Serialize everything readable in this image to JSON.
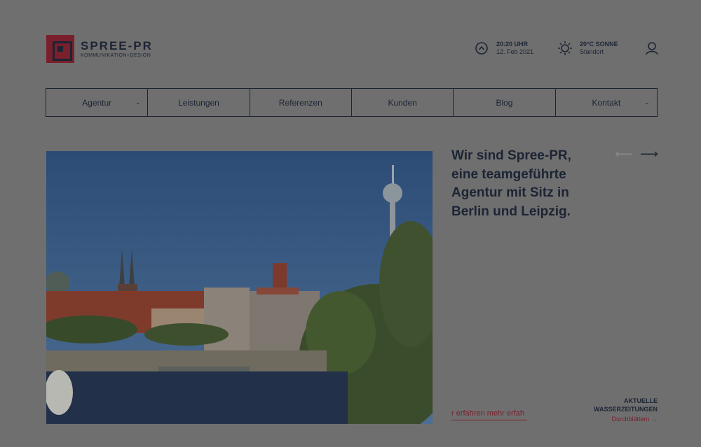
{
  "brand": {
    "name": "SPREE-PR",
    "tagline": "KOMMUNIKATION+DESIGN"
  },
  "header": {
    "time": {
      "value": "20:20 UHR",
      "date": "12. Feb 2021",
      "icon": "clock-icon"
    },
    "weather": {
      "value": "20°C SONNE",
      "location": "Standort",
      "icon": "sun-icon"
    },
    "user_icon": "user-icon"
  },
  "nav": {
    "items": [
      {
        "label": "Agentur",
        "dropdown": true
      },
      {
        "label": "Leistungen",
        "dropdown": false
      },
      {
        "label": "Referenzen",
        "dropdown": false
      },
      {
        "label": "Kunden",
        "dropdown": false
      },
      {
        "label": "Blog",
        "dropdown": false
      },
      {
        "label": "Kontakt",
        "dropdown": true
      }
    ]
  },
  "hero": {
    "headline": "Wir sind Spree-PR, eine teamgeführte Agentur mit Sitz in Berlin und Leipzig.",
    "more_link": "r erfahren mehr erfah",
    "prev_arrow": "⟵",
    "next_arrow": "⟶"
  },
  "water": {
    "title_line1": "AKTUELLE",
    "title_line2": "WASSERZEITUNGEN",
    "link": "Durchblättern →"
  },
  "colors": {
    "accent": "#7a1f2c",
    "text": "#1c2434",
    "overlay_bg": "#6f6f6f"
  }
}
